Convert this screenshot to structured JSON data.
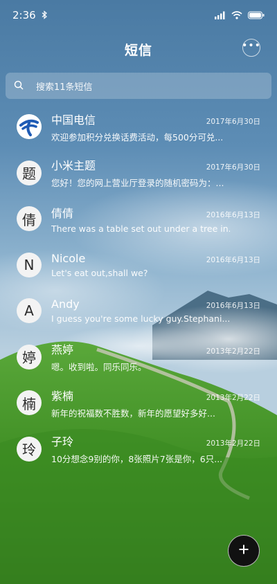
{
  "status_bar": {
    "time": "2:36"
  },
  "header": {
    "title": "短信"
  },
  "search": {
    "placeholder": "搜索11条短信"
  },
  "conversations": [
    {
      "name": "中国电信",
      "date": "2017年6月30日",
      "preview": "欢迎参加积分兑换话费活动，每500分可兑...",
      "avatar_icon": "china-telecom-logo"
    },
    {
      "name": "小米主题",
      "date": "2017年6月30日",
      "preview": "您好！您的网上营业厅登录的随机密码为：...",
      "avatar_char": "题"
    },
    {
      "name": "倩倩",
      "date": "2016年6月13日",
      "preview": "There was a table set out under a tree in...",
      "avatar_char": "倩"
    },
    {
      "name": "Nicole",
      "date": "2016年6月13日",
      "preview": "Let's eat out,shall we?",
      "avatar_char": "N"
    },
    {
      "name": "Andy",
      "date": "2016年6月13日",
      "preview": "I guess you're some lucky guy.Stephani...",
      "avatar_char": "A"
    },
    {
      "name": "燕婷",
      "date": "2013年2月22日",
      "preview": "嗯。收到啦。同乐同乐。",
      "avatar_char": "婷"
    },
    {
      "name": "紫楠",
      "date": "2013年2月22日",
      "preview": "新年的祝福数不胜数，新年的愿望好多好...",
      "avatar_char": "楠"
    },
    {
      "name": "子玲",
      "date": "2013年2月22日",
      "preview": "10分想念9别的你，8张照片7张是你，6只...",
      "avatar_char": "玲"
    }
  ],
  "colors": {
    "fab_background": "#111111",
    "telecom_blue": "#1e5bb5"
  }
}
